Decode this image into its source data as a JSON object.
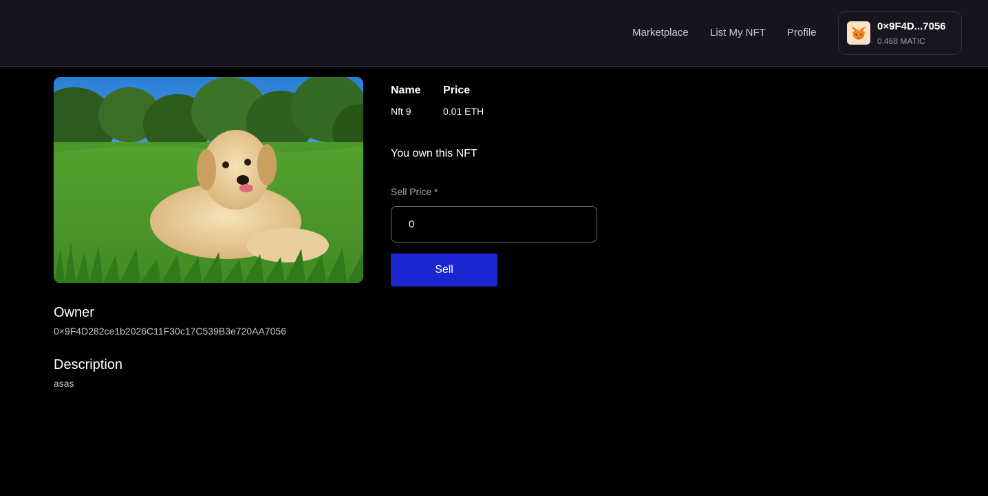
{
  "nav": {
    "links": [
      "Marketplace",
      "List My NFT",
      "Profile"
    ]
  },
  "wallet": {
    "icon": "metamask-fox-icon",
    "address": "0×9F4D...7056",
    "balance": "0.468 MATIC"
  },
  "nft": {
    "image_alt": "golden retriever puppy on grass",
    "name_label": "Name",
    "name_value": "Nft 9",
    "price_label": "Price",
    "price_value": "0.01 ETH",
    "own_text": "You own this NFT",
    "owner_label": "Owner",
    "owner_value": "0×9F4D282ce1b2026C11F30c17C539B3e720AA7056",
    "description_label": "Description",
    "description_value": "asas"
  },
  "sell_form": {
    "label": "Sell Price *",
    "value": "0",
    "button_label": "Sell"
  },
  "colors": {
    "topbar": "#15141f",
    "background": "#000000",
    "accent": "#1b26d1"
  }
}
